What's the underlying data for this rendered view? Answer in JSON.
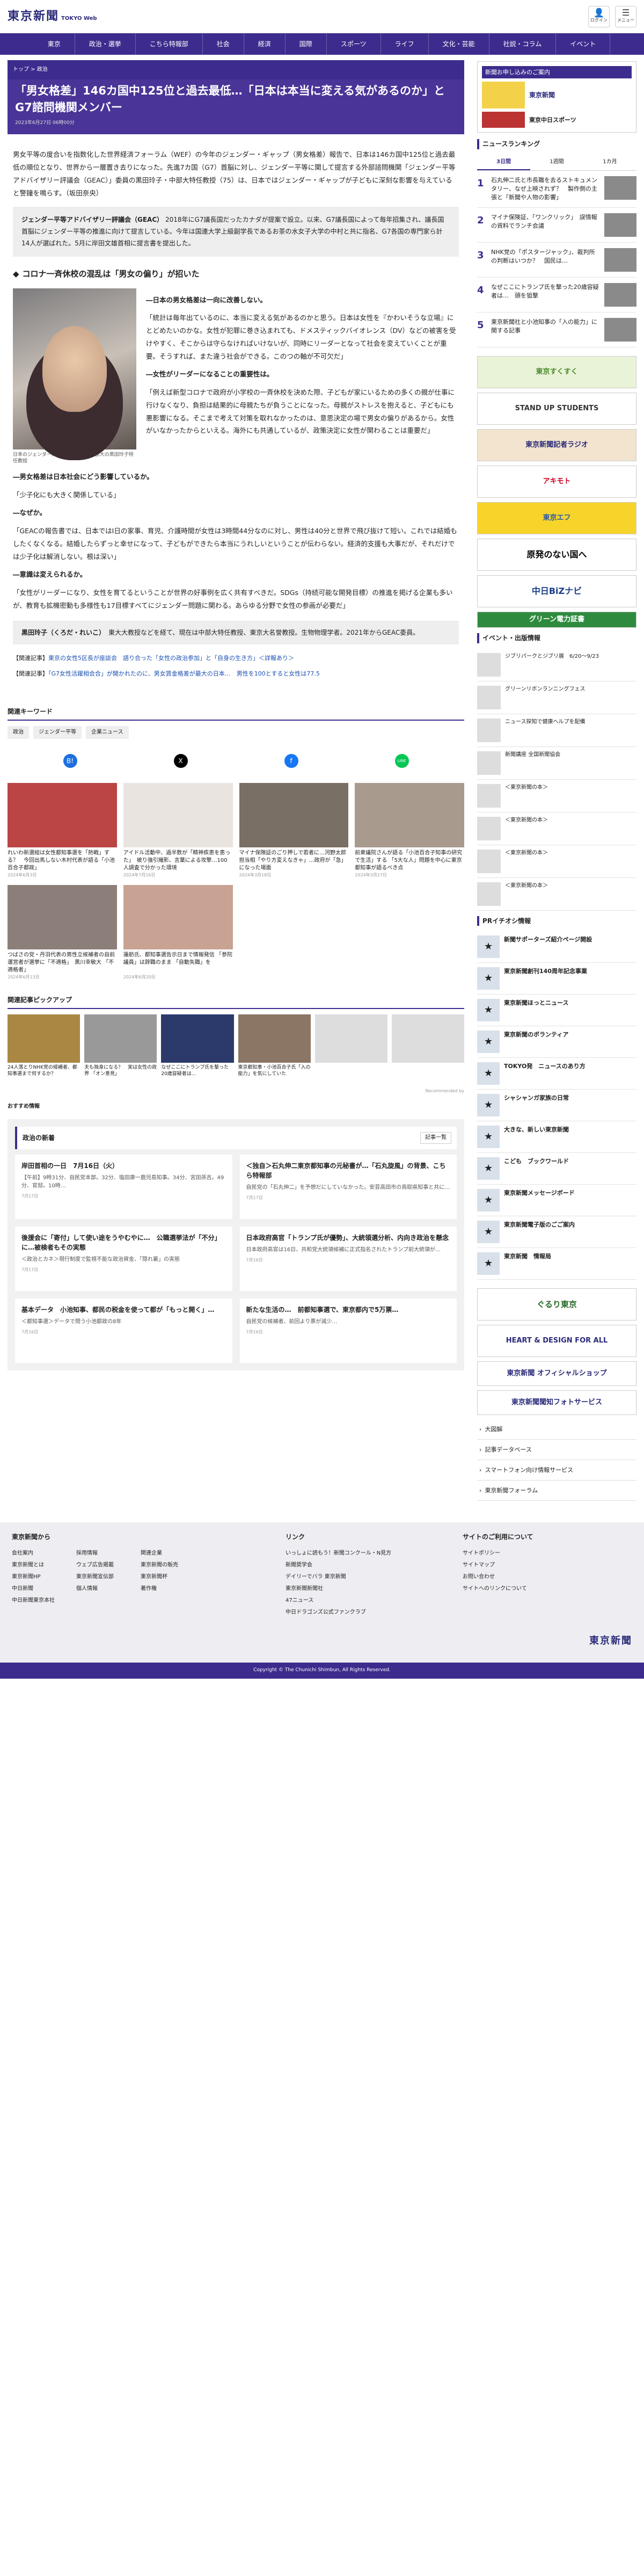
{
  "header": {
    "logo": "東京新聞",
    "logo_sub": "TOKYO Web",
    "btn_login": "ログイン",
    "btn_menu": "メニュー"
  },
  "nav": [
    "東京",
    "政治・選挙",
    "こちら特報部",
    "社会",
    "経済",
    "国際",
    "スポーツ",
    "ライフ",
    "文化・芸能",
    "社説・コラム",
    "イベント"
  ],
  "breadcrumb": "トップ > 政治",
  "article": {
    "title": "「男女格差」146カ国中125位と過去最低…「日本は本当に変える気があるのか」とG7諮問機関メンバー",
    "date": "2023年6月27日 06時00分",
    "lead": "男女平等の度合いを指数化した世界経済フォーラム（WEF）の今年のジェンダー・ギャップ（男女格差）報告で、日本は146カ国中125位と過去最低の順位となり、世界から一層置き去りになった。先進7カ国（G7）首脳に対し、ジェンダー平等に関して提言する外部諮問機関「ジェンダー平等アドバイザリー評議会（GEAC）」委員の黒田玲子・中部大特任教授（75）は、日本ではジェンダー・ギャップが子どもに深刻な影響を与えていると警鐘を鳴らす。（坂田奈央）",
    "info_label": "ジェンダー平等アドバイザリー評議会（GEAC）",
    "info_text": "2018年にG7議長国だったカナダが提案で設立。以来、G7議長国によって毎年招集され、議長国首脳にジェンダー平等の推進に向けて提言している。今年は国連大学上級副学長であるお茶の水女子大学の中村と共に指名、G7各国の専門家ら計14人が選ばれた。5月に岸田文雄首相に提言書を提出した。",
    "subhead": "コロナ一斉休校の混乱は「男女の偏り」が招いた",
    "photo_caption": "日本のジェンダー問題について話す中部大の黒田玲子特任教授",
    "q1": "―日本の男女格差は一向に改善しない。",
    "a1": "「統計は毎年出ているのに、本当に変える気があるのかと思う。日本は女性を『かわいそうな立場』にとどめたいのかな。女性が犯罪に巻き込まれても、ドメスティックバイオレンス（DV）などの被害を受けやすく、そこからは守らなければいけないが、同時にリーダーとなって社会を変えていくことが重要。そうすれば、また違う社会ができる。このつの軸が不可欠だ」",
    "q2": "―女性がリーダーになることの重要性は。",
    "a2": "「例えば新型コロナで政府が小学校の一斉休校を決めた際、子どもが家にいるための多くの親が仕事に行けなくなり、負担は結果的に母親たちが負うことになった。母親がストレスを抱えると、子どもにも悪影響になる。そこまで考えて対策を取れなかったのは、意思決定の場で男女の偏りがあるから。女性がいなかったからといえる。海外にも共通しているが、政策決定に女性が関わることは重要だ」",
    "q3": "―男女格差は日本社会にどう影響しているか。",
    "a3": "「少子化にも大きく関係している」",
    "q4": "―なぜか。",
    "a4": "「GEACの報告書では、日本ではⅠ日の家事、育児、介護時間が女性は3時間44分なのに対し、男性は40分と世界で飛び抜けて短い。これでは結婚もしたくなくなる。結婚したらずっと幸せになって、子どもができたら本当にうれしいということが伝わらない。経済的支援も大事だが、それだけでは少子化は解消しない。根は深い」",
    "q5": "―意識は変えられるか。",
    "a5": "「女性がリーダーになり、女性を育てるということが世界の好事例を広く共有すべきだ。SDGs（持続可能な開発目標）の推進を掲げる企業も多いが、教育も拡機密動も多様性も17目標すべてにジェンダー問題に関わる。あらゆる分野で女性の参画が必要だ」",
    "profile_name": "黒田玲子（くろだ・れいこ）",
    "profile_text": "東大大教授などを経て、現在は中部大特任教授、東京大名誉教授。生物物理学者。2021年からGEAC委員。",
    "related1_prefix": "【関連記事】",
    "related1": "東京の女性5区長が座談会　語り合った「女性の政治参加」と「自身の生き方」＜詳報あり＞",
    "related2_prefix": "【関連記事】",
    "related2": "「G7女性活躍相会合」が開かれたのに、男女賃金格差が最大の日本…　男性を100とすると女性は77.5"
  },
  "keywords_title": "関連キーワード",
  "keywords": [
    "政治",
    "ジェンダー平等",
    "企業ニュース"
  ],
  "share": [
    "B!",
    "X",
    "f",
    "LINE"
  ],
  "related_cards": [
    {
      "t": "れいわ新選組は女性都知事選を「熱戦」する？　今回出馬しない木村代表が語る「小池百合子都政」",
      "d": "2024年6月3日"
    },
    {
      "t": "アイドル活動中、過半数が「精神疾患を患った」　被り強引撮影、言葉による攻撃…100人調査で分かった環境",
      "d": "2024年7月16日"
    },
    {
      "t": "マイナ保険証のごり押しで若者に…河野太郎担当相「やり方変えなきゃ」…政府が「急」になった場面",
      "d": "2024年3月18日"
    },
    {
      "t": "前衆議院さんが語る「小池百合子知事の研究で生活」する 「5大な人」問題を中心に東京都知事が語るべき点",
      "d": "2024年3月27日"
    },
    {
      "t": "つばさの党・丹羽代表の男性立候補者の自前運営者が選挙に「不適格」　黒川幸敏大 「不適格者」",
      "d": "2024年6月13日"
    },
    {
      "t": "蓮舫氏、都知事選告示日まで情報発信 「参院議員」は辞職のまま 「自動失職」を",
      "d": "2024年6月20日"
    }
  ],
  "pickup_title": "関連記事ピックアップ",
  "pickup": [
    {
      "t": "24人落とりNHK党の候補者、都知事選まで何するか？",
      "d": "2024年7月10日"
    },
    {
      "t": "夫も独身になる？　実は女性の政界 「オン意見」",
      "d": "2024年7月16日"
    },
    {
      "t": "なぜここにトランプ氏を撃った20歳容疑者は…",
      "d": "2024年7月14日"
    },
    {
      "t": "東京都知事・小池百合子氏「入の能力」を気にしていた",
      "d": "2024年7月15日"
    },
    {
      "t": "",
      "d": ""
    },
    {
      "t": "",
      "d": ""
    }
  ],
  "pickup_footer": "Recommended by",
  "recommend_title": "おすすめ情報",
  "politics": {
    "title": "政治の新着",
    "more": "記事一覧",
    "items": [
      {
        "t": "岸田首相の一日　7月16日（火）",
        "s": "【午前】9時31分、自民党本部。32分、塩田康一鹿児島知事。34分、宮田孫吉。49分、官邸。10時…",
        "d": "7月17日"
      },
      {
        "t": "＜独自＞石丸伸二東京都知事の元秘書が…「石丸旋風」の背景、こちら特報部",
        "s": "自民党の「石丸伸二」を予想だにしていなかった。安芸高田市の鳥取県知事と共に…",
        "d": "7月17日"
      },
      {
        "t": "後援会に「寄付」して使い途をうやむやに…　公職選挙法が「不分」に…被検者もその実態",
        "s": "＜政治とカネ＞現行制度で監視不能な政治資金、「隠れ蓑」の実態",
        "d": "7月17日"
      },
      {
        "t": "日本政府高官「トランプ氏が優勢」、大統領選分析、内向き政治を懸念",
        "s": "日本政府高官は16日、共和党大統領候補に正式指名されたトランプ前大統領が…",
        "d": "7月16日"
      },
      {
        "t": "基本データ　小池知事、都民の税金を使って都が「もっと開く」…",
        "s": "＜都知事選＞データで問う小池都政の8年",
        "d": "7月16日"
      },
      {
        "t": "新たな生活の…　前都知事選で、東京都内で5万票…",
        "s": "自民党の候補者、前回より票が減少…",
        "d": "7月16日"
      }
    ]
  },
  "footer": {
    "col1_title": "東京新聞から",
    "col1a": [
      "会社案内",
      "東京新聞とは",
      "東京新聞HP",
      "中日新聞",
      "中日新聞東京本社"
    ],
    "col1b": [
      "採用情報",
      "ウェブ広告掲載",
      "東京新聞宣伝部",
      "個人情報"
    ],
    "col1c": [
      "関連企業",
      "東京新聞の販売",
      "東京新聞杯",
      "著作権"
    ],
    "col2_title": "リンク",
    "col2": [
      "いっしょに読もう！新聞コンクール・N見方",
      "新聞奨学会",
      "デイリーでバラ 東京新聞",
      "東京新聞新聞社",
      "47ニュース",
      "中日ドラゴンズ公式ファンクラブ"
    ],
    "col3_title": "サイトのご利用について",
    "col3": [
      "サイトポリシー",
      "サイトマップ",
      "お問い合わせ",
      "サイトへのリンクについて"
    ],
    "logo": "東京新聞",
    "copyright": "Copyright © The Chunichi Shimbun, All Rights Reserved."
  },
  "side": {
    "promo_title": "新聞お申し込みのご案内",
    "promo_items": [
      "東京新聞",
      "東京中日スポーツ"
    ],
    "ranking_title": "ニュースランキング",
    "rank_tabs": [
      "3日間",
      "1週間",
      "1カ月"
    ],
    "rank": [
      {
        "n": "1",
        "t": "石丸伸二氏と市長職を去るストキュメンタリー、なぜ上映されず？　製作側の主張と「新聞や人物の影響」"
      },
      {
        "n": "2",
        "t": "マイナ保険証、「ワンクリック」　誤情報の資料でランチ会議"
      },
      {
        "n": "3",
        "t": "NHK党の「ポスタージャック」、裁判所の判断はいつか？　国民は…"
      },
      {
        "n": "4",
        "t": "なぜここにトランプ氏を撃った20歳容疑者は…　頭を狙撃"
      },
      {
        "n": "5",
        "t": "東京新聞社と小池知事の「入の能力」に関する記事"
      }
    ],
    "banners": [
      "東京すくすく",
      "STAND UP STUDENTS",
      "東京新聞記者ラジオ",
      "アキモト",
      "東京エフ",
      "原発のない国へ",
      "中日BiZナビ",
      "グリーン電力証書"
    ],
    "events_title": "イベント・出版情報",
    "events": [
      {
        "t": "ジブリパークとジブリ展　6/20〜9/23"
      },
      {
        "t": "グリーンリボンランニングフェス"
      },
      {
        "t": "ニュース探知で健康ヘルプを配備"
      },
      {
        "t": "新聞講座 全国新聞協会"
      },
      {
        "t": "＜東京新聞の本＞"
      },
      {
        "t": "＜東京新聞の本＞"
      },
      {
        "t": "＜東京新聞の本＞"
      },
      {
        "t": "＜東京新聞の本＞"
      }
    ],
    "pr_title": "PRイチオシ情報",
    "pr": [
      {
        "t": "新聞サポーターズ紹介ページ開設"
      },
      {
        "t": "東京新聞創刊140周年記念事業"
      },
      {
        "t": "東京新聞ほっとニュース"
      },
      {
        "t": "東京新聞のボランティア"
      },
      {
        "t": "TOKYO発　ニュースのあり方"
      },
      {
        "t": "シャシャンガ家族の日常"
      },
      {
        "t": "大きな、新しい東京新聞"
      },
      {
        "t": "こども　ブックワールド"
      },
      {
        "t": "東京新聞メッセージボード"
      },
      {
        "t": "東京新聞電子版のごご案内"
      },
      {
        "t": "東京新聞　情報局"
      }
    ],
    "side_banners": [
      "ぐるり東京",
      "HEART & DESIGN FOR ALL",
      "東京新聞 オフィシャルショップ",
      "東京新聞聞知フォトサービス"
    ],
    "side_links": [
      "大図解",
      "記事データベース",
      "スマートフォン向け情報サービス",
      "東京新聞フォーラム"
    ]
  }
}
